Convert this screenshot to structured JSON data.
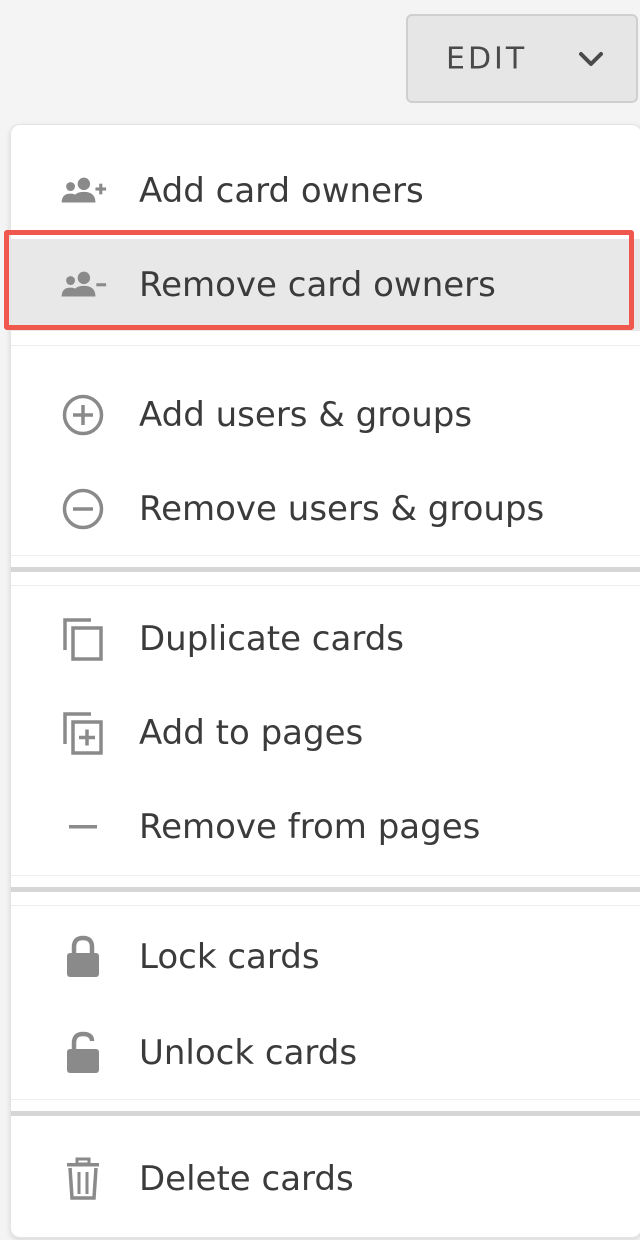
{
  "header": {
    "edit_label": "EDIT",
    "chevron_icon": "chevron-down-icon"
  },
  "menu": {
    "groups": [
      {
        "items": [
          {
            "label": "Add card owners",
            "icon": "user-group-add-icon"
          },
          {
            "label": "Remove card owners",
            "icon": "user-group-remove-icon",
            "highlighted": true
          }
        ]
      },
      {
        "items": [
          {
            "label": "Add users & groups",
            "icon": "plus-circle-icon"
          },
          {
            "label": "Remove users & groups",
            "icon": "minus-circle-icon"
          }
        ]
      },
      {
        "items": [
          {
            "label": "Duplicate cards",
            "icon": "copy-icon"
          },
          {
            "label": "Add to pages",
            "icon": "add-to-page-icon"
          },
          {
            "label": "Remove from pages",
            "icon": "minus-icon"
          }
        ]
      },
      {
        "items": [
          {
            "label": "Lock cards",
            "icon": "lock-icon"
          },
          {
            "label": "Unlock cards",
            "icon": "unlock-icon"
          }
        ]
      },
      {
        "items": [
          {
            "label": "Delete cards",
            "icon": "trash-icon"
          }
        ]
      }
    ]
  },
  "colors": {
    "highlight_border": "#f0574f",
    "icon_gray": "#8a8a8a",
    "text": "#3b3b3b"
  }
}
